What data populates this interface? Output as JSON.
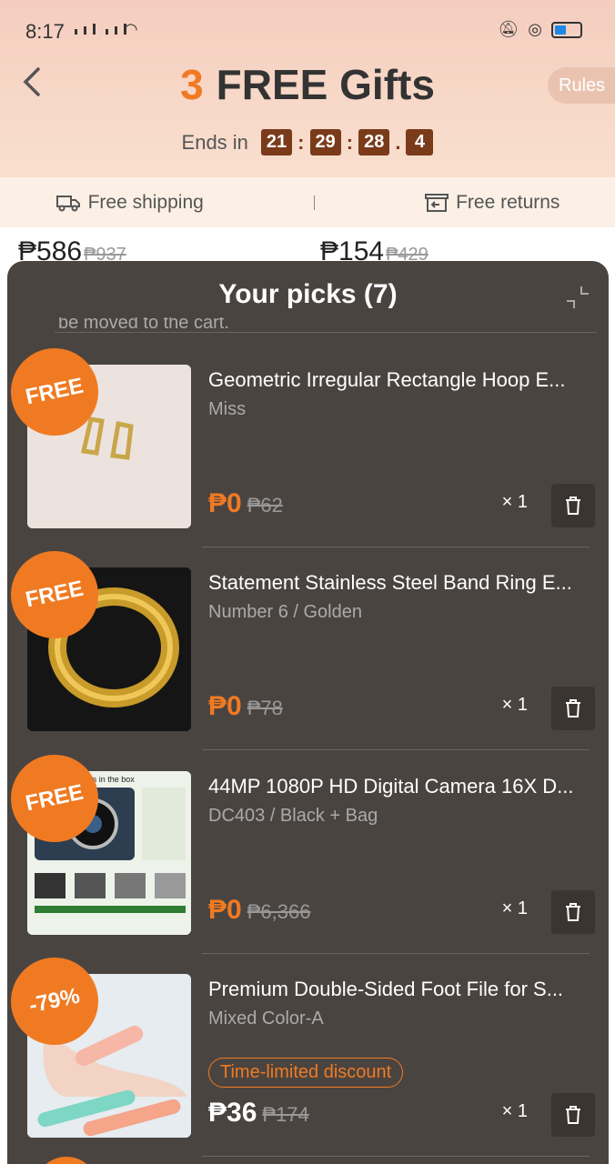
{
  "status_bar": {
    "time": "8:17"
  },
  "header": {
    "title_number": "3",
    "title_text": "FREE Gifts",
    "rules_label": "Rules",
    "countdown_label": "Ends in",
    "countdown": [
      "21",
      "29",
      "28",
      "4"
    ]
  },
  "benefits": {
    "shipping": "Free shipping",
    "returns": "Free returns"
  },
  "peek": [
    {
      "price": "₱586",
      "old": "₱937"
    },
    {
      "price": "₱154",
      "old": "₱429"
    }
  ],
  "sheet": {
    "title": "Your picks (7)",
    "cut_text": "be moved to the cart.",
    "items": [
      {
        "badge": "FREE",
        "title": "Geometric Irregular Rectangle Hoop E...",
        "variant": "Miss",
        "price": "₱0",
        "old_price": "₱62",
        "qty": "× 1"
      },
      {
        "badge": "FREE",
        "title": "Statement Stainless Steel Band Ring E...",
        "variant": "Number 6 / Golden",
        "price": "₱0",
        "old_price": "₱78",
        "qty": "× 1"
      },
      {
        "badge": "FREE",
        "title": "44MP 1080P HD Digital Camera 16X D...",
        "variant": "DC403 / Black + Bag",
        "price": "₱0",
        "old_price": "₱6,366",
        "qty": "× 1",
        "image_text": "'s in the box"
      },
      {
        "badge": "-79%",
        "title": "Premium Double-Sided Foot File for S...",
        "variant": "Mixed Color-A",
        "tag": "Time-limited discount",
        "price": "₱36",
        "old_price": "₱174",
        "qty": "× 1"
      }
    ]
  },
  "colors": {
    "accent": "#f07a22",
    "sheet_bg": "#4a4441",
    "countdown_bg": "#7a3b1a"
  }
}
